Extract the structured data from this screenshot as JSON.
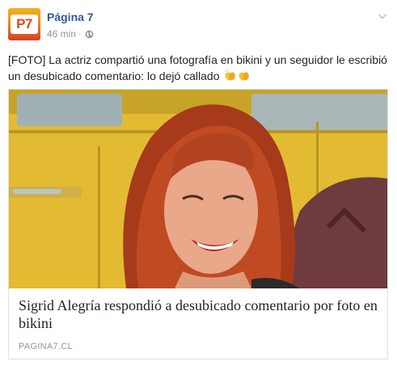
{
  "post": {
    "page_name": "Página 7",
    "timestamp": "46 min",
    "separator": "·",
    "privacy_icon": "globe-icon",
    "menu_icon": "chevron-down-icon",
    "avatar_text": "P7",
    "caption": "[FOTO] La actriz compartió una fotografía en bikini y un seguidor le escribió un desubicado comentario: lo dejó callado",
    "caption_emoji": "clapping-hands-icon"
  },
  "link_card": {
    "title": "Sigrid Alegría respondió a desubicado comentario por foto en bikini",
    "domain": "PAGINA7.CL",
    "image": "woman-with-red-hair-smiling-photo"
  },
  "colors": {
    "link_blue": "#365899",
    "meta_gray": "#90949c",
    "text": "#1d2129",
    "border": "#dddfe2"
  }
}
